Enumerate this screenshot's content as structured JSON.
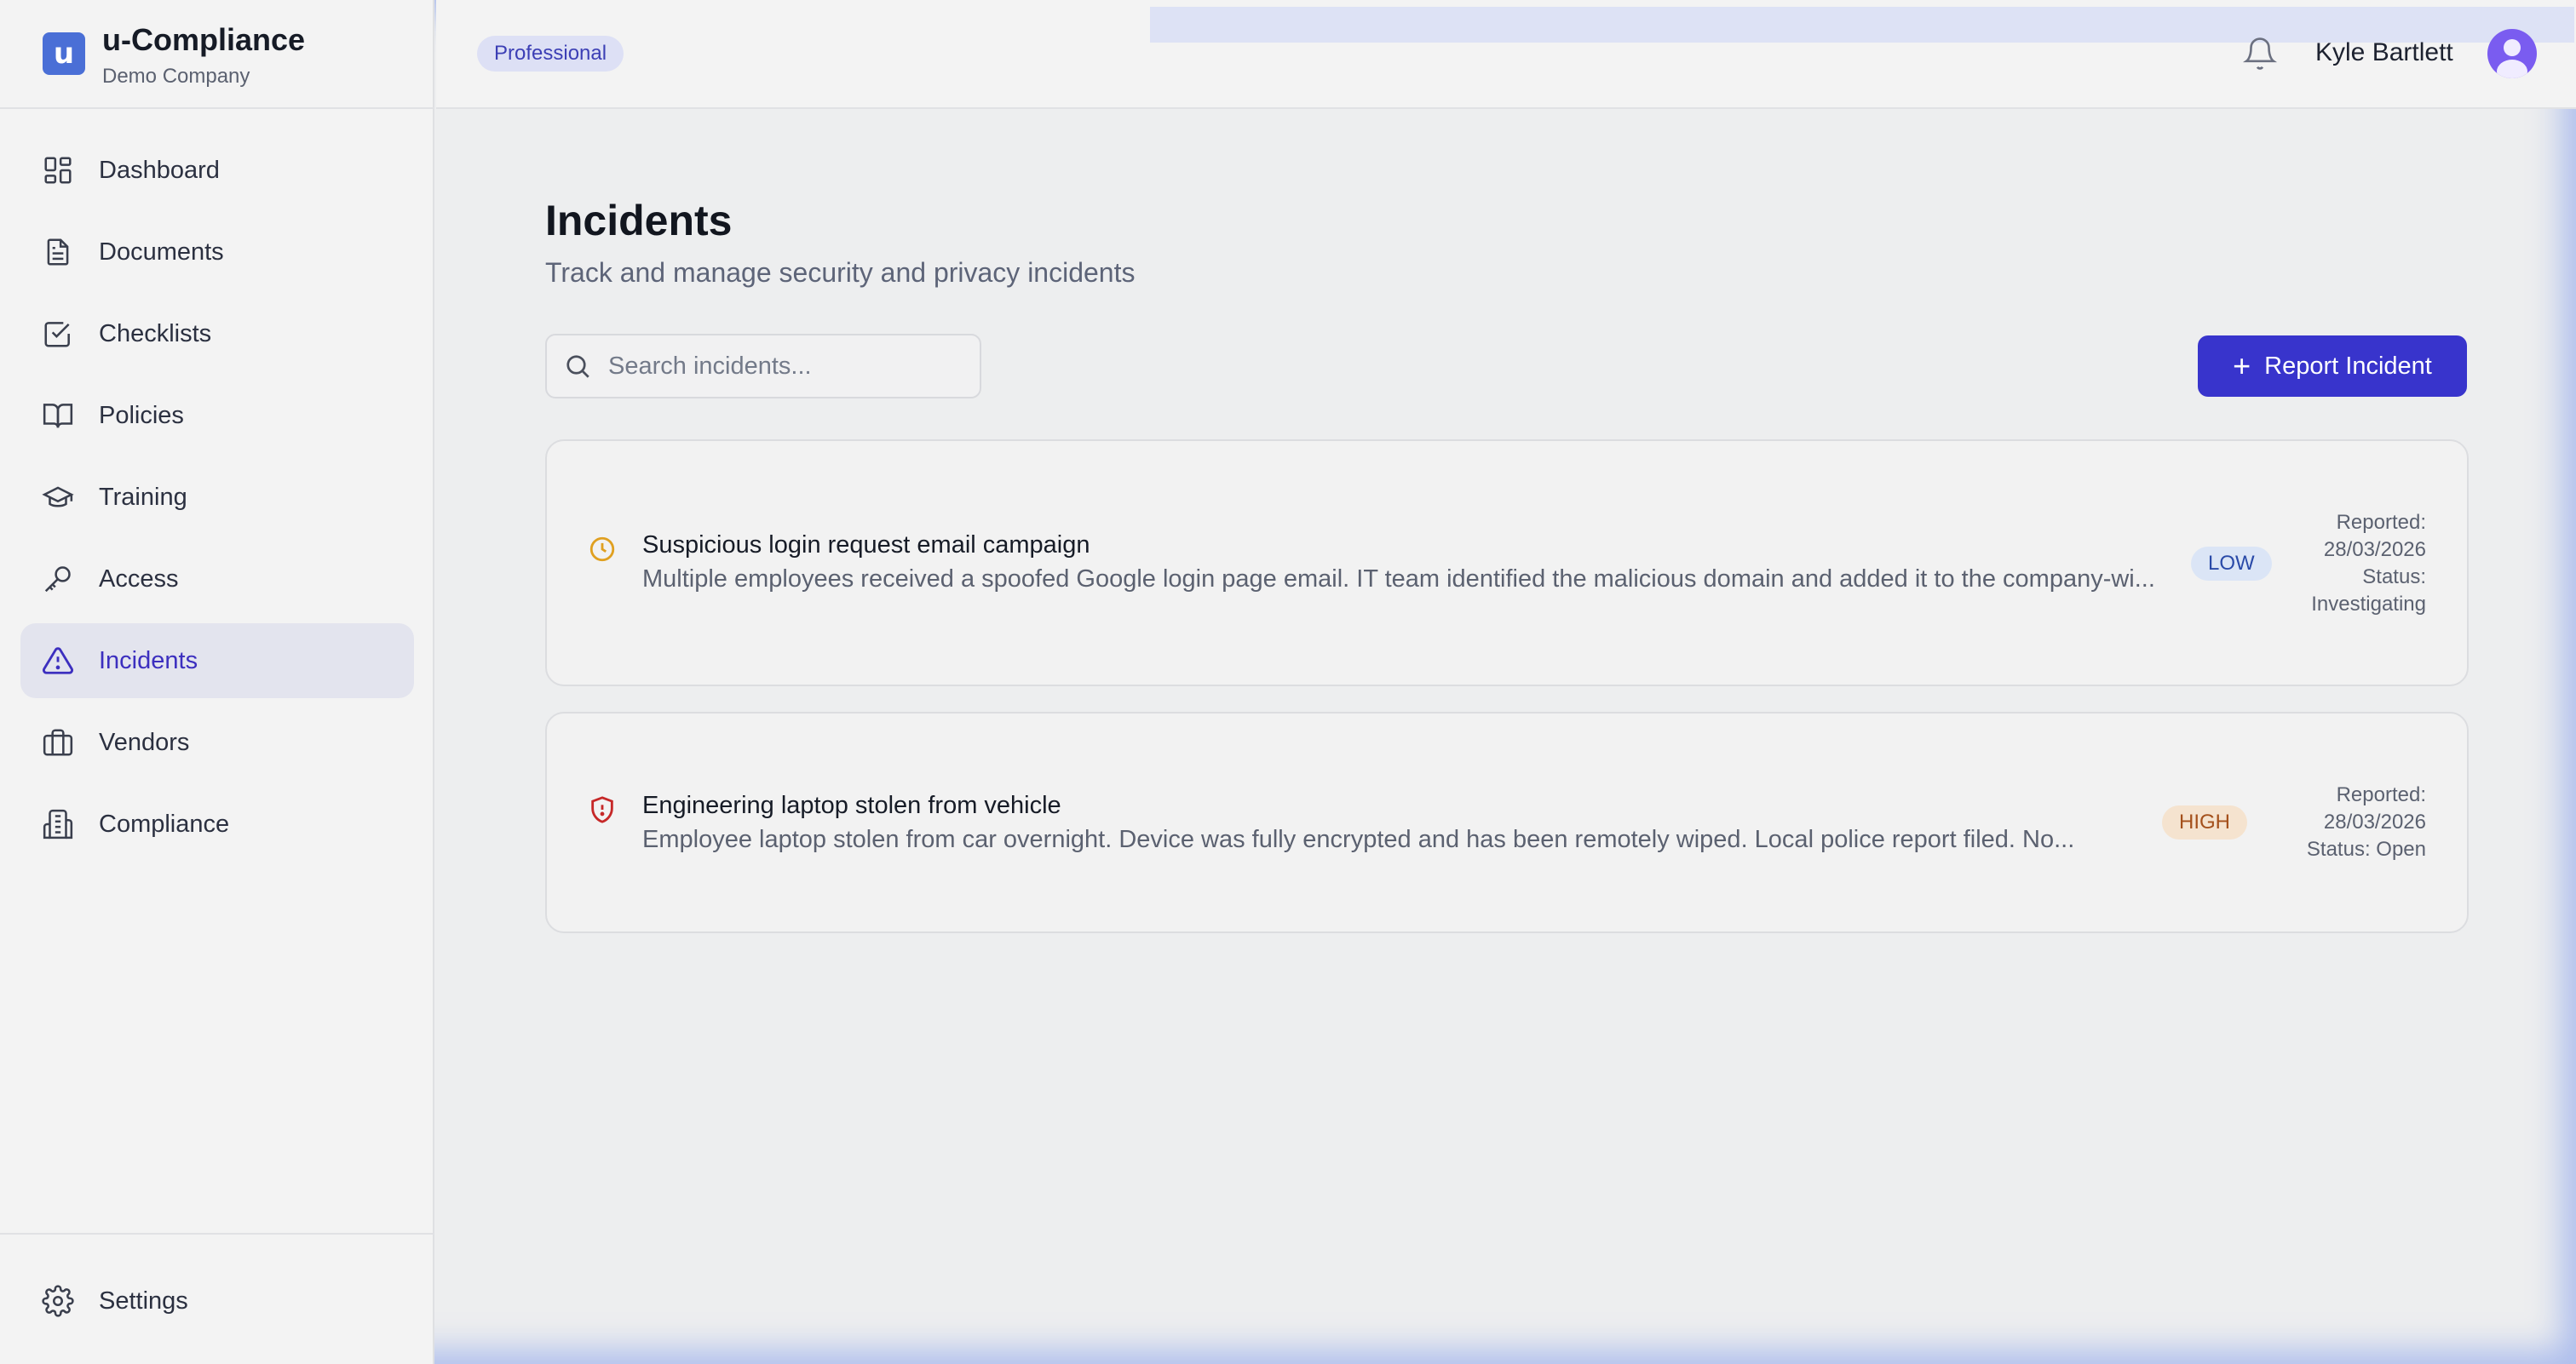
{
  "brand": {
    "logo_letter": "u",
    "name": "u-Compliance",
    "company": "Demo Company"
  },
  "sidebar": {
    "items": [
      {
        "label": "Dashboard",
        "icon": "dashboard-icon"
      },
      {
        "label": "Documents",
        "icon": "document-icon"
      },
      {
        "label": "Checklists",
        "icon": "checklist-icon"
      },
      {
        "label": "Policies",
        "icon": "book-icon"
      },
      {
        "label": "Training",
        "icon": "graduation-cap-icon"
      },
      {
        "label": "Access",
        "icon": "key-icon"
      },
      {
        "label": "Incidents",
        "icon": "warning-triangle-icon",
        "active": true
      },
      {
        "label": "Vendors",
        "icon": "briefcase-icon"
      },
      {
        "label": "Compliance",
        "icon": "building-icon"
      }
    ],
    "settings_label": "Settings"
  },
  "header": {
    "plan": "Professional",
    "user_name": "Kyle Bartlett"
  },
  "page": {
    "title": "Incidents",
    "subtitle": "Track and manage security and privacy incidents",
    "search_placeholder": "Search incidents...",
    "report_button": "Report Incident"
  },
  "incidents": [
    {
      "title": "Suspicious login request email campaign",
      "description": "Multiple employees received a spoofed Google login page email. IT team identified the malicious domain and added it to the company-wi...",
      "severity": "LOW",
      "reported_line": "Reported:",
      "reported_date": "28/03/2026",
      "status_line_1": "Status:",
      "status_line_2": "Investigating",
      "icon": "clock-icon"
    },
    {
      "title": "Engineering laptop stolen from vehicle",
      "description": "Employee laptop stolen from car overnight. Device was fully encrypted and has been remotely wiped. Local police report filed. No...",
      "severity": "HIGH",
      "reported_line": "Reported:",
      "reported_date": "28/03/2026",
      "status_line_1": "Status: Open",
      "icon": "shield-alert-icon"
    }
  ],
  "colors": {
    "accent": "#3834cc",
    "active_nav_text": "#3c2fbf",
    "low_badge": "#dbe5f6",
    "high_badge": "#f5e3cf",
    "clock_icon": "#e0a020",
    "shield_icon": "#c62828"
  }
}
